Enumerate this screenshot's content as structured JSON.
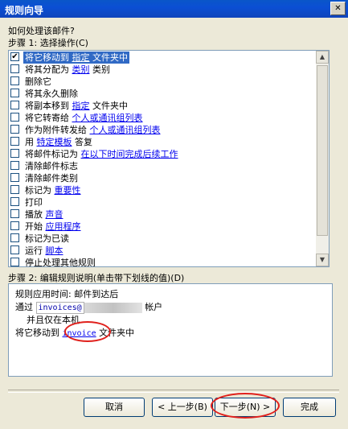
{
  "window": {
    "title": "规则向导",
    "close_glyph": "✕"
  },
  "question": "如何处理该邮件?",
  "step1_label": "步骤 1: 选择操作(C)",
  "actions": [
    {
      "checked": true,
      "before": "将它移动到",
      "link": "指定",
      "after": "文件夹中"
    },
    {
      "checked": false,
      "before": "将其分配为",
      "link": "类别",
      "after": "类别"
    },
    {
      "checked": false,
      "before": "删除它",
      "link": "",
      "after": ""
    },
    {
      "checked": false,
      "before": "将其永久删除",
      "link": "",
      "after": ""
    },
    {
      "checked": false,
      "before": "将副本移到",
      "link": "指定",
      "after": "文件夹中"
    },
    {
      "checked": false,
      "before": "将它转寄给",
      "link": "个人或通讯组列表",
      "after": ""
    },
    {
      "checked": false,
      "before": "作为附件转发给",
      "link": "个人或通讯组列表",
      "after": ""
    },
    {
      "checked": false,
      "before": "用",
      "link": "特定模板",
      "after": "答复"
    },
    {
      "checked": false,
      "before": "将邮件标记为",
      "link": "在以下时间完成后续工作",
      "after": ""
    },
    {
      "checked": false,
      "before": "清除邮件标志",
      "link": "",
      "after": ""
    },
    {
      "checked": false,
      "before": "清除邮件类别",
      "link": "",
      "after": ""
    },
    {
      "checked": false,
      "before": "标记为",
      "link": "重要性",
      "after": ""
    },
    {
      "checked": false,
      "before": "打印",
      "link": "",
      "after": ""
    },
    {
      "checked": false,
      "before": "播放",
      "link": "声音",
      "after": ""
    },
    {
      "checked": false,
      "before": "开始",
      "link": "应用程序",
      "after": ""
    },
    {
      "checked": false,
      "before": "标记为已读",
      "link": "",
      "after": ""
    },
    {
      "checked": false,
      "before": "运行",
      "link": "脚本",
      "after": ""
    },
    {
      "checked": false,
      "before": "停止处理其他规则",
      "link": "",
      "after": ""
    }
  ],
  "step2_label": "步骤 2: 编辑规则说明(单击带下划线的值)(D)",
  "description": {
    "line1": "规则应用时间: 邮件到达后",
    "line2_prefix": "通过",
    "line2_account": "invoices@",
    "line2_suffix": "帐户",
    "line3": "并且仅在本机",
    "line4_prefix": "将它移动到",
    "line4_link": "invoice",
    "line4_suffix": "文件夹中"
  },
  "buttons": {
    "cancel": "取消",
    "back": "< 上一步(B)",
    "next": "下一步(N) >",
    "finish": "完成"
  },
  "colors": {
    "title_blue": "#0b4fd4",
    "selection": "#316ac5",
    "annotation_red": "#e0201c"
  }
}
